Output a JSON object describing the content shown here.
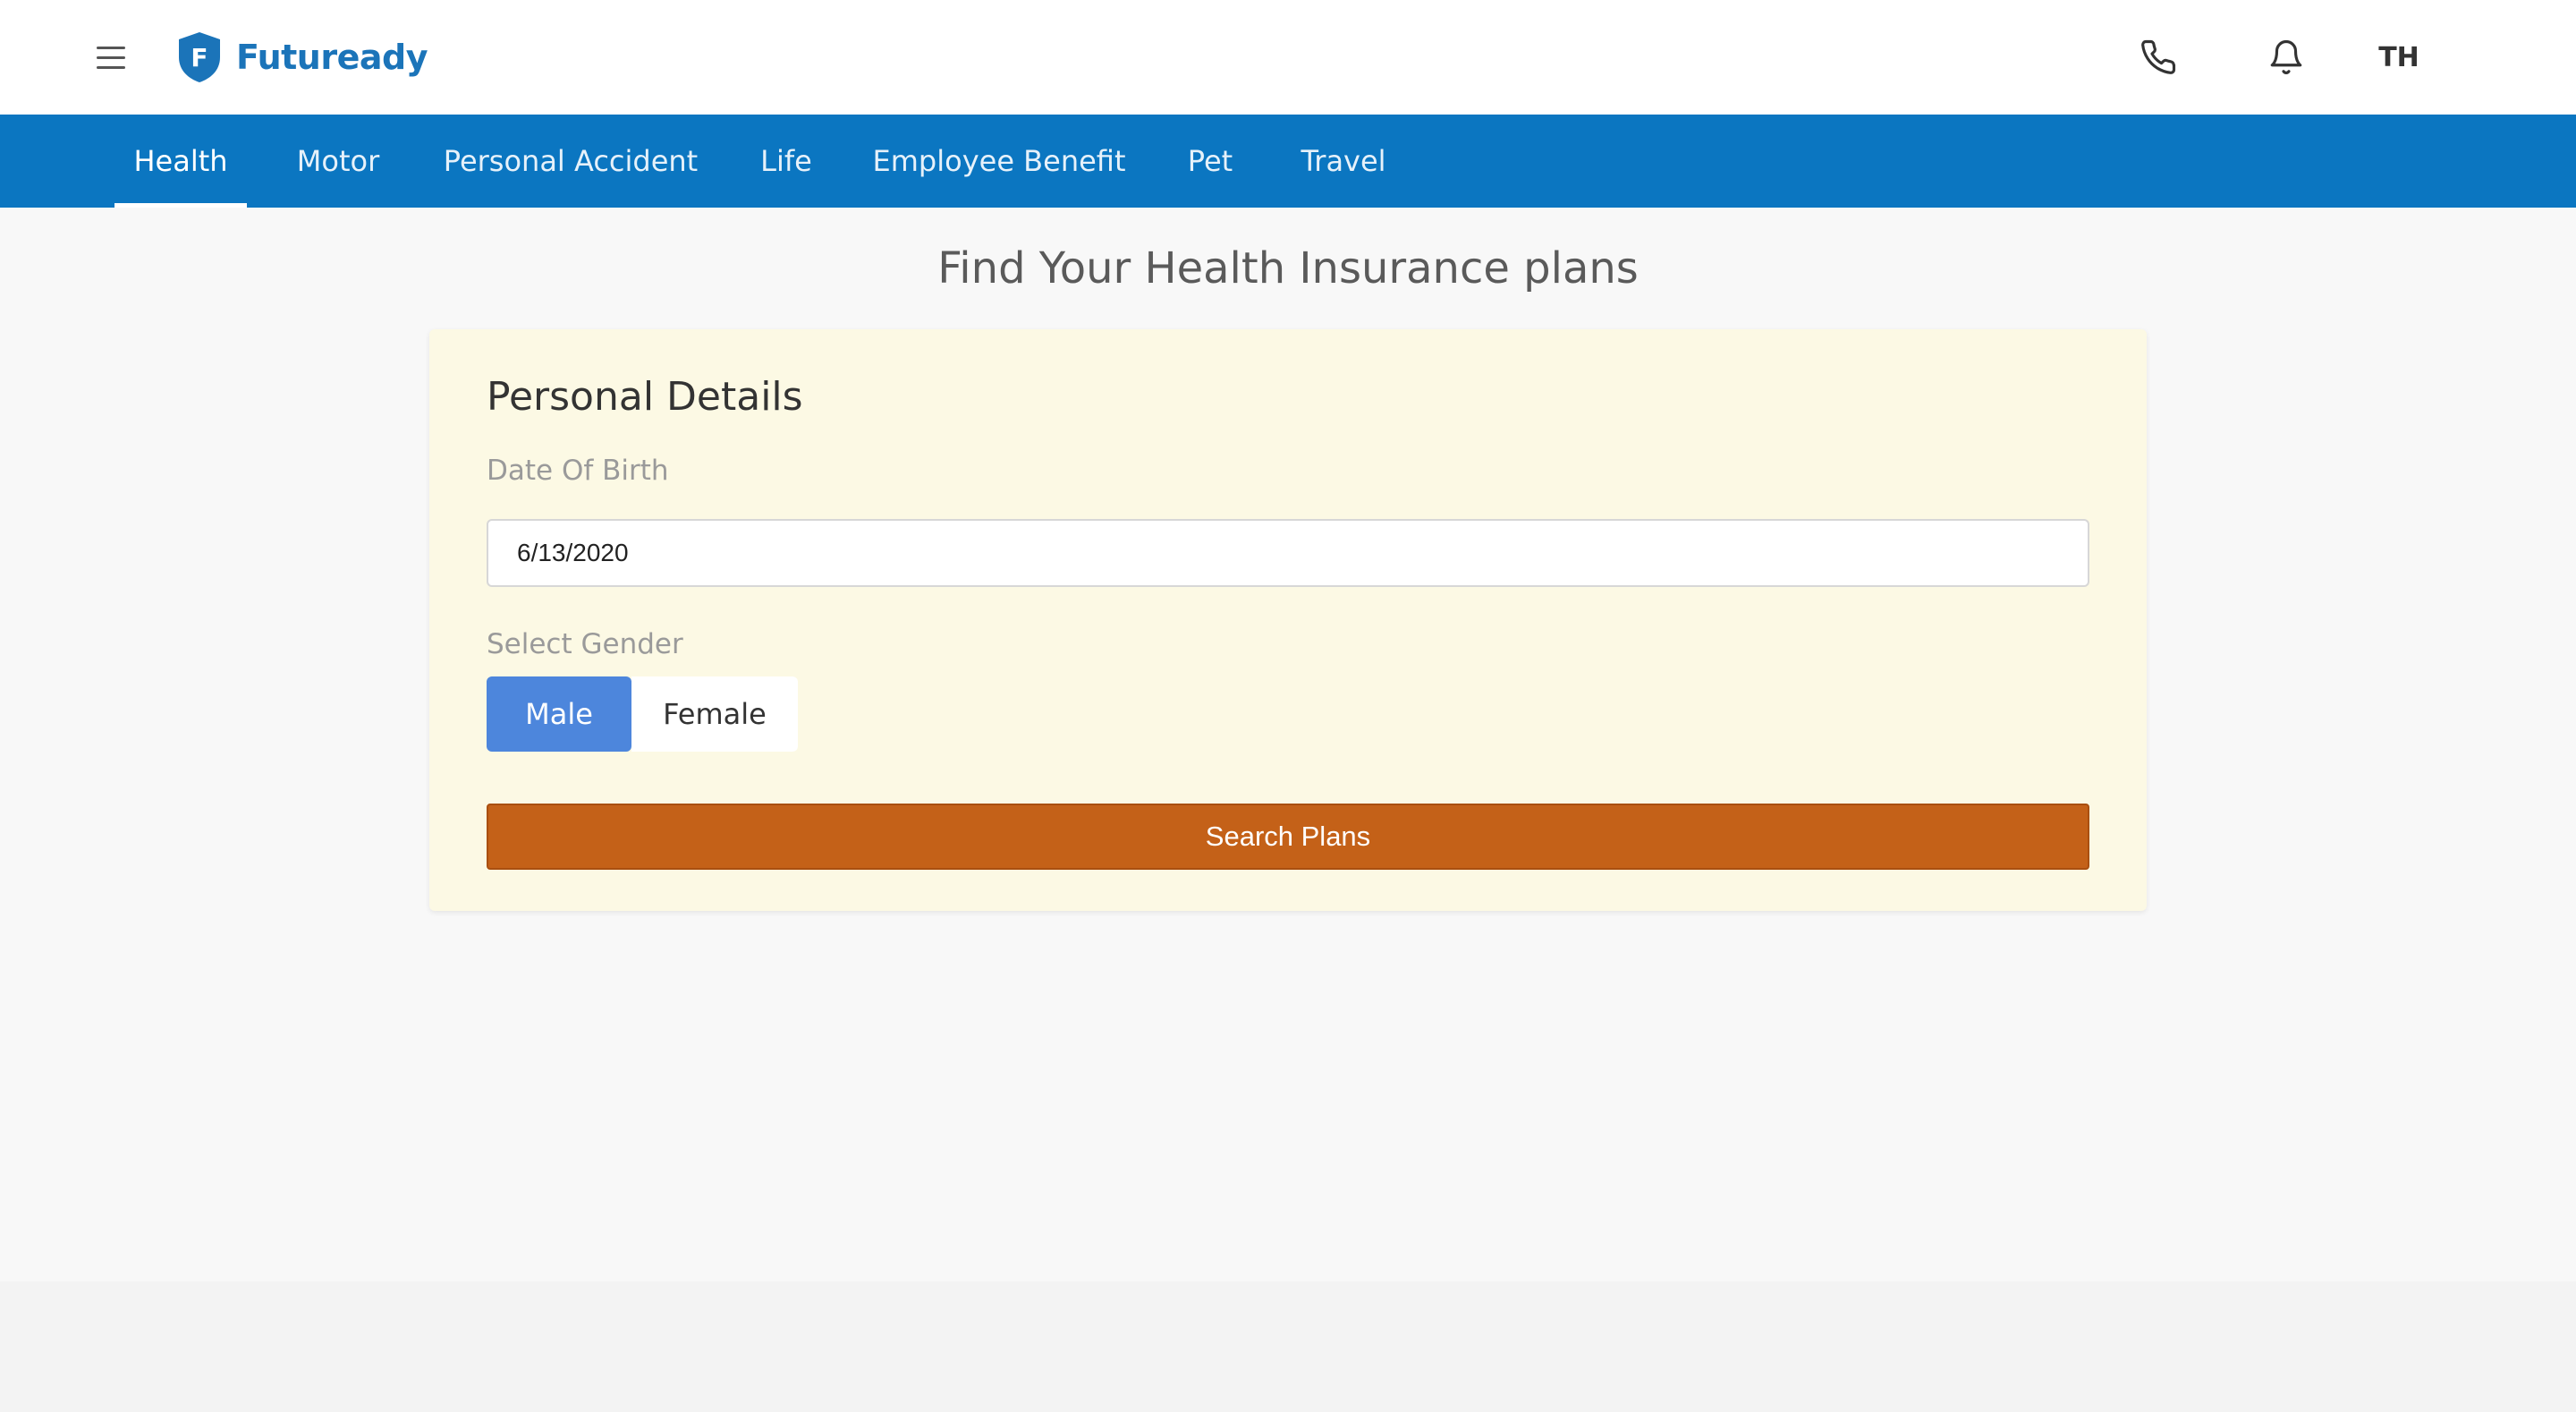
{
  "header": {
    "menu_icon": "hamburger-icon",
    "logo_text": "Futuready",
    "logo_letter": "F",
    "phone_icon": "phone-icon",
    "bell_icon": "bell-icon",
    "avatar_initials": "TH",
    "brand_color": "#1b74b9"
  },
  "nav": {
    "tabs": [
      {
        "label": "Health",
        "active": true
      },
      {
        "label": "Motor"
      },
      {
        "label": "Personal Accident"
      },
      {
        "label": "Life"
      },
      {
        "label": "Employee Benefit"
      },
      {
        "label": "Pet"
      },
      {
        "label": "Travel"
      }
    ],
    "bg_color": "#0b76c1"
  },
  "main": {
    "title": "Find Your Health Insurance plans",
    "card": {
      "title": "Personal Details",
      "dob_label": "Date Of Birth",
      "dob_value": "6/13/2020",
      "gender_label": "Select Gender",
      "gender_options": [
        "Male",
        "Female"
      ],
      "gender_selected": "Male",
      "search_label": "Search Plans",
      "card_bg": "#fcf9e4",
      "selected_color": "#4d86dc",
      "search_color": "#c46118"
    }
  }
}
